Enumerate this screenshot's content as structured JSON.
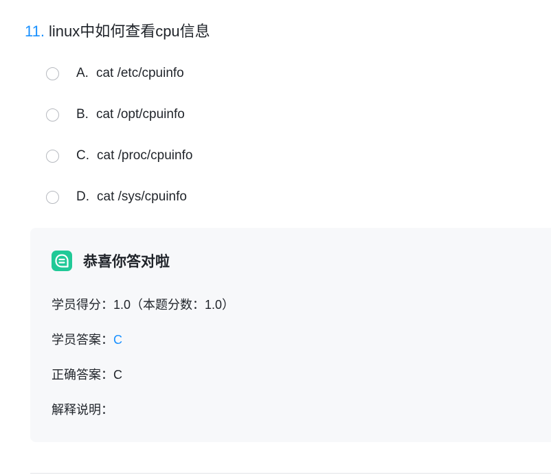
{
  "question": {
    "number": "11.",
    "text": "linux中如何查看cpu信息",
    "options": [
      {
        "letter": "A.",
        "text": "cat /etc/cpuinfo"
      },
      {
        "letter": "B.",
        "text": "cat /opt/cpuinfo"
      },
      {
        "letter": "C.",
        "text": "cat /proc/cpuinfo"
      },
      {
        "letter": "D.",
        "text": "cat /sys/cpuinfo"
      }
    ]
  },
  "result": {
    "icon": "chat-bubble-icon",
    "icon_color": "#20c997",
    "title": "恭喜你答对啦",
    "score_label": "学员得分：",
    "score_value": "1.0（本题分数：1.0）",
    "student_answer_label": "学员答案：",
    "student_answer_value": "C",
    "correct_answer_label": "正确答案：",
    "correct_answer_value": "C",
    "explanation_label": "解释说明："
  },
  "colors": {
    "accent": "#1890ff",
    "panel_bg": "#f7f8fa",
    "text": "#1f2329",
    "radio_border": "#b6b9bf"
  }
}
